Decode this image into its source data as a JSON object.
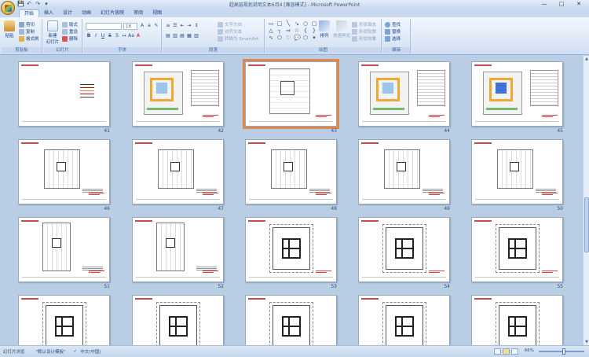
{
  "window": {
    "title": "超高层规划说明文本6月4 [兼容模式] - Microsoft PowerPoint",
    "controls": [
      "—",
      "□",
      "✕"
    ]
  },
  "qat": [
    "💾",
    "↶",
    "↷",
    "▾"
  ],
  "tabs": [
    "开始",
    "插入",
    "设计",
    "动画",
    "幻灯片放映",
    "审阅",
    "视图"
  ],
  "active_tab": "开始",
  "ribbon": {
    "clipboard": {
      "paste": "粘贴",
      "cut": "剪切",
      "copy": "复制",
      "format_painter": "格式刷",
      "label": "剪贴板"
    },
    "slides": {
      "new_slide": "新建\n幻灯片",
      "layout": "版式",
      "reset": "重设",
      "delete": "删除",
      "label": "幻灯片"
    },
    "font": {
      "font_name": "",
      "font_size": "18",
      "label": "字体"
    },
    "paragraph": {
      "text_direction": "文字方向",
      "align_text": "对齐文本",
      "convert_smartart": "转换为 SmartArt",
      "label": "段落"
    },
    "drawing": {
      "arrange": "排列",
      "quick_styles": "快速样式",
      "shape_fill": "形状填充",
      "shape_outline": "形状轮廓",
      "shape_effects": "形状效果",
      "label": "绘图"
    },
    "editing": {
      "find": "查找",
      "replace": "替换",
      "select": "选择",
      "label": "编辑"
    }
  },
  "slides": [
    {
      "num": "41",
      "kind": "legend"
    },
    {
      "num": "42",
      "kind": "site-color"
    },
    {
      "num": "43",
      "kind": "site-plan",
      "selected": true
    },
    {
      "num": "44",
      "kind": "site-color"
    },
    {
      "num": "45",
      "kind": "site-color-blue"
    },
    {
      "num": "46",
      "kind": "floor-plan"
    },
    {
      "num": "47",
      "kind": "floor-plan"
    },
    {
      "num": "48",
      "kind": "floor-plan"
    },
    {
      "num": "49",
      "kind": "floor-plan"
    },
    {
      "num": "50",
      "kind": "floor-plan"
    },
    {
      "num": "51",
      "kind": "floor-plan-dense"
    },
    {
      "num": "52",
      "kind": "floor-plan-dense"
    },
    {
      "num": "53",
      "kind": "tower"
    },
    {
      "num": "54",
      "kind": "tower"
    },
    {
      "num": "55",
      "kind": "tower"
    },
    {
      "num": "",
      "kind": "tower"
    },
    {
      "num": "",
      "kind": "tower"
    },
    {
      "num": "",
      "kind": "tower"
    },
    {
      "num": "",
      "kind": "tower"
    },
    {
      "num": "",
      "kind": "tower"
    }
  ],
  "statusbar": {
    "view": "幻灯片浏览",
    "theme": "\"默认设计模板\"",
    "language": "中文(中国)",
    "zoom": "66%"
  },
  "colors": {
    "ribbon_bg": "#dbe7f6",
    "workspace_bg": "#b9cde5",
    "selected_outline": "#e0874a"
  }
}
